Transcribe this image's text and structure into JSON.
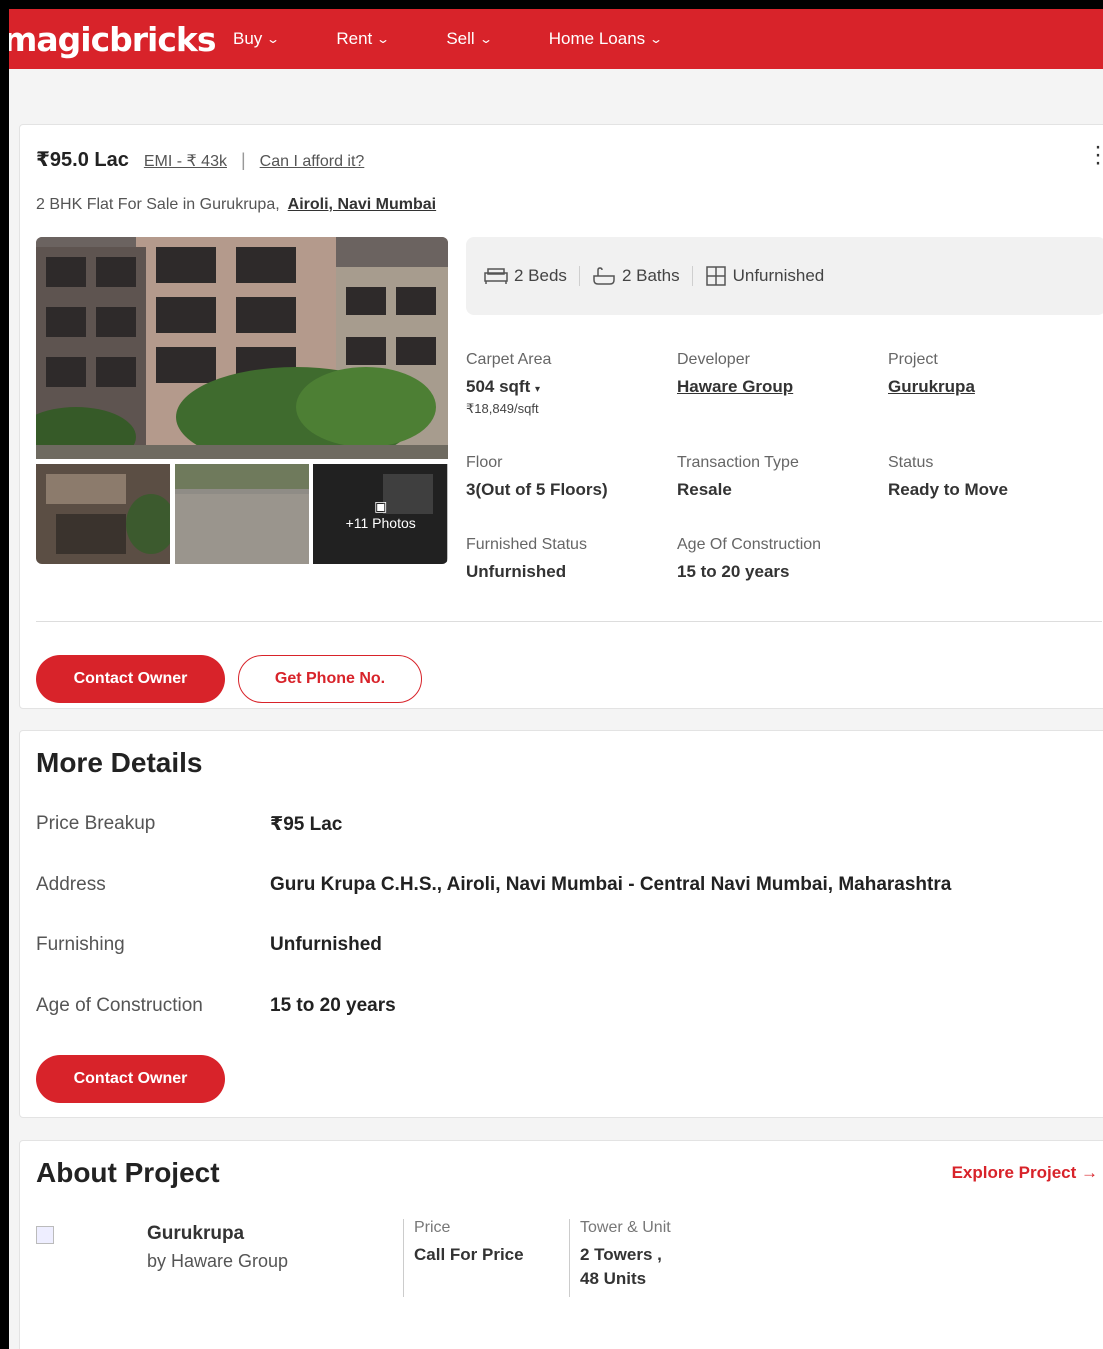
{
  "header": {
    "logo": "magicbricks",
    "nav": [
      {
        "label": "Buy"
      },
      {
        "label": "Rent"
      },
      {
        "label": "Sell"
      },
      {
        "label": "Home Loans"
      }
    ]
  },
  "listing": {
    "price": "₹95.0 Lac",
    "emi": "EMI - ₹ 43k",
    "afford": "Can I afford it?",
    "title": "2 BHK Flat For Sale in Gurukrupa,",
    "location": "Airoli, Navi Mumbai",
    "photos_more": "+11 Photos",
    "features": {
      "beds": "2 Beds",
      "baths": "2 Baths",
      "furnish": "Unfurnished"
    },
    "attributes": {
      "carpet_label": "Carpet Area",
      "carpet_value": "504 sqft",
      "carpet_rate": "₹18,849/sqft",
      "developer_label": "Developer",
      "developer_value": "Haware Group",
      "project_label": "Project",
      "project_value": "Gurukrupa",
      "floor_label": "Floor",
      "floor_value": "3(Out of 5 Floors)",
      "transaction_label": "Transaction Type",
      "transaction_value": "Resale",
      "status_label": "Status",
      "status_value": "Ready to Move",
      "furnished_label": "Furnished Status",
      "furnished_value": "Unfurnished",
      "age_label": "Age Of Construction",
      "age_value": "15 to 20 years"
    },
    "contact_btn": "Contact Owner",
    "phone_btn": "Get Phone No."
  },
  "more_details": {
    "title": "More Details",
    "rows": [
      {
        "k": "Price Breakup",
        "v": "₹95 Lac"
      },
      {
        "k": "Address",
        "v": "Guru Krupa C.H.S., Airoli, Navi Mumbai - Central Navi Mumbai, Maharashtra"
      },
      {
        "k": "Furnishing",
        "v": "Unfurnished"
      },
      {
        "k": "Age of Construction",
        "v": "15 to 20 years"
      }
    ],
    "contact_btn": "Contact Owner"
  },
  "about_project": {
    "title": "About Project",
    "explore": "Explore Project →",
    "name": "Gurukrupa",
    "by": "by Haware Group",
    "price_label": "Price",
    "price_value": "Call For Price",
    "tower_label": "Tower & Unit",
    "tower_line1": "2 Towers ,",
    "tower_line2": "48 Units"
  },
  "colors": {
    "brand": "#d8232a"
  }
}
